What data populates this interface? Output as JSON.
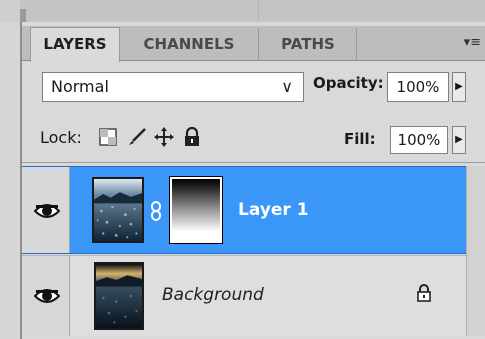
{
  "tabs": [
    {
      "label": "LAYERS",
      "active": true
    },
    {
      "label": "CHANNELS",
      "active": false
    },
    {
      "label": "PATHS",
      "active": false
    }
  ],
  "panel_menu_icon": "panel-menu-icon",
  "blend_mode": {
    "value": "Normal"
  },
  "opacity": {
    "label": "Opacity:",
    "value": "100%"
  },
  "lock": {
    "label": "Lock:",
    "icons": [
      "lock-transparent-pixels-icon",
      "lock-image-pixels-icon",
      "lock-position-icon",
      "lock-all-icon"
    ]
  },
  "fill": {
    "label": "Fill:",
    "value": "100%"
  },
  "layers": [
    {
      "name": "Layer 1",
      "selected": true,
      "visible": true,
      "has_mask": true,
      "linked": true
    },
    {
      "name": "Background",
      "selected": false,
      "visible": true,
      "locked": true
    }
  ],
  "colors": {
    "selection": "#3b97f7",
    "panel": "#d9d9d9"
  }
}
